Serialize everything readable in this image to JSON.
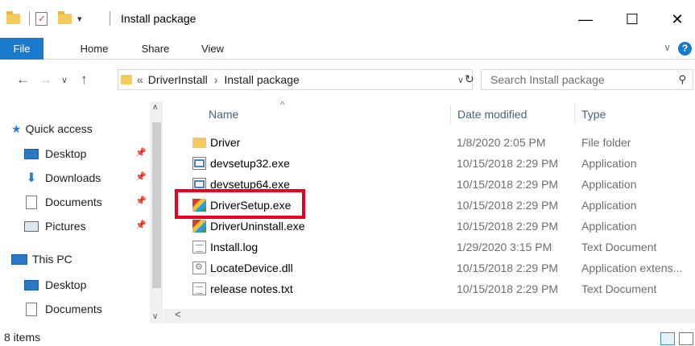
{
  "window": {
    "title": "Install package",
    "minimize_glyph": "—",
    "maximize_glyph": "☐",
    "close_glyph": "✕"
  },
  "ribbon": {
    "tabs": [
      "File",
      "Home",
      "Share",
      "View"
    ],
    "help_glyph": "?",
    "collapse_glyph": "∨"
  },
  "address": {
    "overflow": "«",
    "breadcrumb": [
      "DriverInstall",
      "Install package"
    ],
    "separator": "›",
    "search_placeholder": "Search Install package"
  },
  "nav": {
    "quick_access": "Quick access",
    "items": [
      {
        "label": "Desktop",
        "icon": "desktop-icon",
        "pinned": true
      },
      {
        "label": "Downloads",
        "icon": "downloads-icon",
        "pinned": true
      },
      {
        "label": "Documents",
        "icon": "documents-icon",
        "pinned": true
      },
      {
        "label": "Pictures",
        "icon": "pictures-icon",
        "pinned": true
      }
    ],
    "this_pc": "This PC",
    "pc_items": [
      {
        "label": "Desktop",
        "icon": "desktop-icon"
      },
      {
        "label": "Documents",
        "icon": "documents-icon"
      }
    ]
  },
  "columns": {
    "name": "Name",
    "date": "Date modified",
    "type": "Type"
  },
  "files": [
    {
      "name": "Driver",
      "date": "1/8/2020 2:05 PM",
      "type": "File folder",
      "icon": "folder-icon"
    },
    {
      "name": "devsetup32.exe",
      "date": "10/15/2018 2:29 PM",
      "type": "Application",
      "icon": "app-icon"
    },
    {
      "name": "devsetup64.exe",
      "date": "10/15/2018 2:29 PM",
      "type": "Application",
      "icon": "app-icon"
    },
    {
      "name": "DriverSetup.exe",
      "date": "10/15/2018 2:29 PM",
      "type": "Application",
      "icon": "setup-icon",
      "highlighted": true
    },
    {
      "name": "DriverUninstall.exe",
      "date": "10/15/2018 2:29 PM",
      "type": "Application",
      "icon": "setup-icon"
    },
    {
      "name": "Install.log",
      "date": "1/29/2020 3:15 PM",
      "type": "Text Document",
      "icon": "text-file-icon"
    },
    {
      "name": "LocateDevice.dll",
      "date": "10/15/2018 2:29 PM",
      "type": "Application extens...",
      "icon": "dll-icon"
    },
    {
      "name": "release notes.txt",
      "date": "10/15/2018 2:29 PM",
      "type": "Text Document",
      "icon": "text-file-icon"
    }
  ],
  "status": {
    "item_count": "8 items"
  },
  "colors": {
    "accent": "#1979ca",
    "highlight_box": "#e8001c"
  }
}
